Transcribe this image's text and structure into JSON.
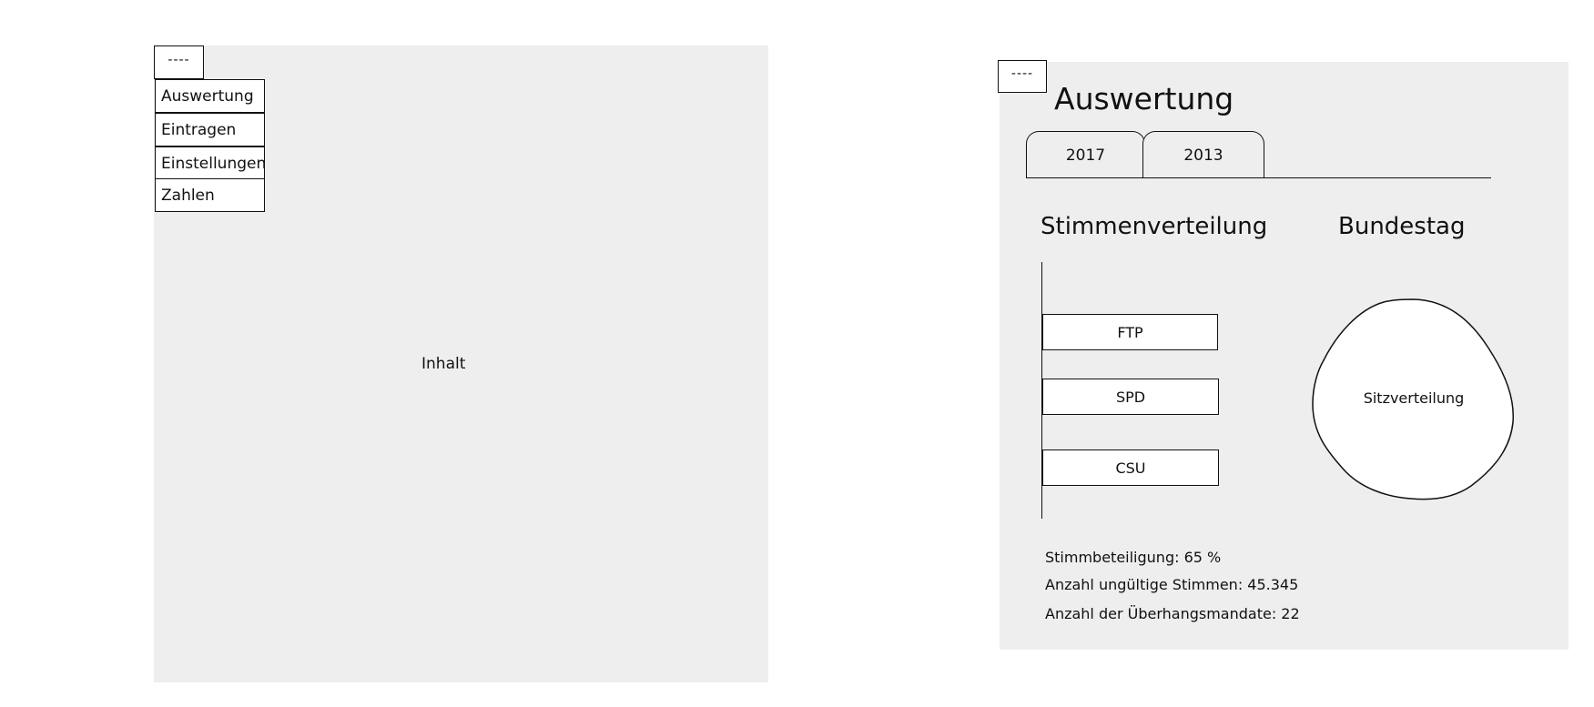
{
  "left_screen": {
    "menu_toggle": "----",
    "menu_items": [
      "Auswertung",
      "Eintragen",
      "Einstellungen",
      "Zahlen"
    ],
    "content_placeholder": "Inhalt"
  },
  "right_screen": {
    "menu_toggle": "----",
    "title": "Auswertung",
    "tabs": [
      "2017",
      "2013"
    ],
    "vote_section": {
      "title": "Stimmenverteilung",
      "bars": [
        "FTP",
        "SPD",
        "CSU"
      ]
    },
    "parliament_section": {
      "title": "Bundestag",
      "chart_label": "Sitzverteilung"
    },
    "stats": [
      "Stimmbeteiligung: 65 %",
      "Anzahl ungültige Stimmen: 45.345",
      "Anzahl der Überhangsmandate: 22"
    ]
  }
}
